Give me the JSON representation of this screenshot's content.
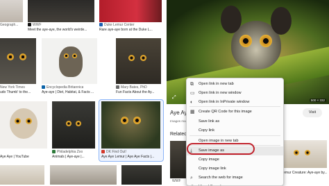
{
  "results": [
    {
      "source": "Geograph...",
      "title": ""
    },
    {
      "source": "WWF",
      "title": "Meet the aye-aye, the world's weirde..."
    },
    {
      "source": "Duke Lemur Center",
      "title": "Rare aye-aye born at the Duke L..."
    },
    {
      "source": "New York Times",
      "title": "udo Thumb' to the..."
    },
    {
      "source": "Encyclopedia Britannica",
      "title": "Aye-aye | Diet, Habitat, & Facts ..."
    },
    {
      "source": "Mary Bates, PhD",
      "title": "Fun Facts About the Ay..."
    },
    {
      "source": "",
      "title": "Aye Aye | YouTube"
    },
    {
      "source": "Philadelphia Zoo",
      "title": "Animals | Aye-aye |..."
    },
    {
      "source": "DK Find Out!",
      "title": "Aye Aye Lemur | Aye Aye Facts |..."
    },
    {
      "source": "",
      "title": ""
    },
    {
      "source": "WWF",
      "title": ""
    }
  ],
  "preview": {
    "title": "Aye Aye",
    "subtitle": "Images ma",
    "size_label": "500 × 332",
    "visit_label": "Visit",
    "related_label": "Related",
    "related_caption": "lemur Creature: Aye-aye by..."
  },
  "context_menu": {
    "items": [
      {
        "label": "Open link in new tab",
        "icon": "new-tab-icon"
      },
      {
        "label": "Open link in new window",
        "icon": "new-window-icon"
      },
      {
        "label": "Open link in InPrivate window",
        "icon": "inprivate-icon"
      },
      {
        "label": "Create QR Code for this image",
        "icon": "qr-code-icon"
      },
      {
        "label": "Save link as",
        "icon": ""
      },
      {
        "label": "Copy link",
        "icon": ""
      },
      {
        "label": "Open image in new tab",
        "icon": ""
      },
      {
        "label": "Save image as",
        "icon": "save-icon"
      },
      {
        "label": "Copy image",
        "icon": ""
      },
      {
        "label": "Copy image link",
        "icon": ""
      },
      {
        "label": "Search the web for image",
        "icon": "search-web-icon"
      },
      {
        "label": "Visual Search",
        "icon": "visual-search-icon"
      }
    ],
    "highlighted": "Save image as"
  },
  "colors": {
    "highlight_ring": "#c0202a",
    "visit_button": "#f0f0f0",
    "selected_border": "#8ab4f8"
  }
}
